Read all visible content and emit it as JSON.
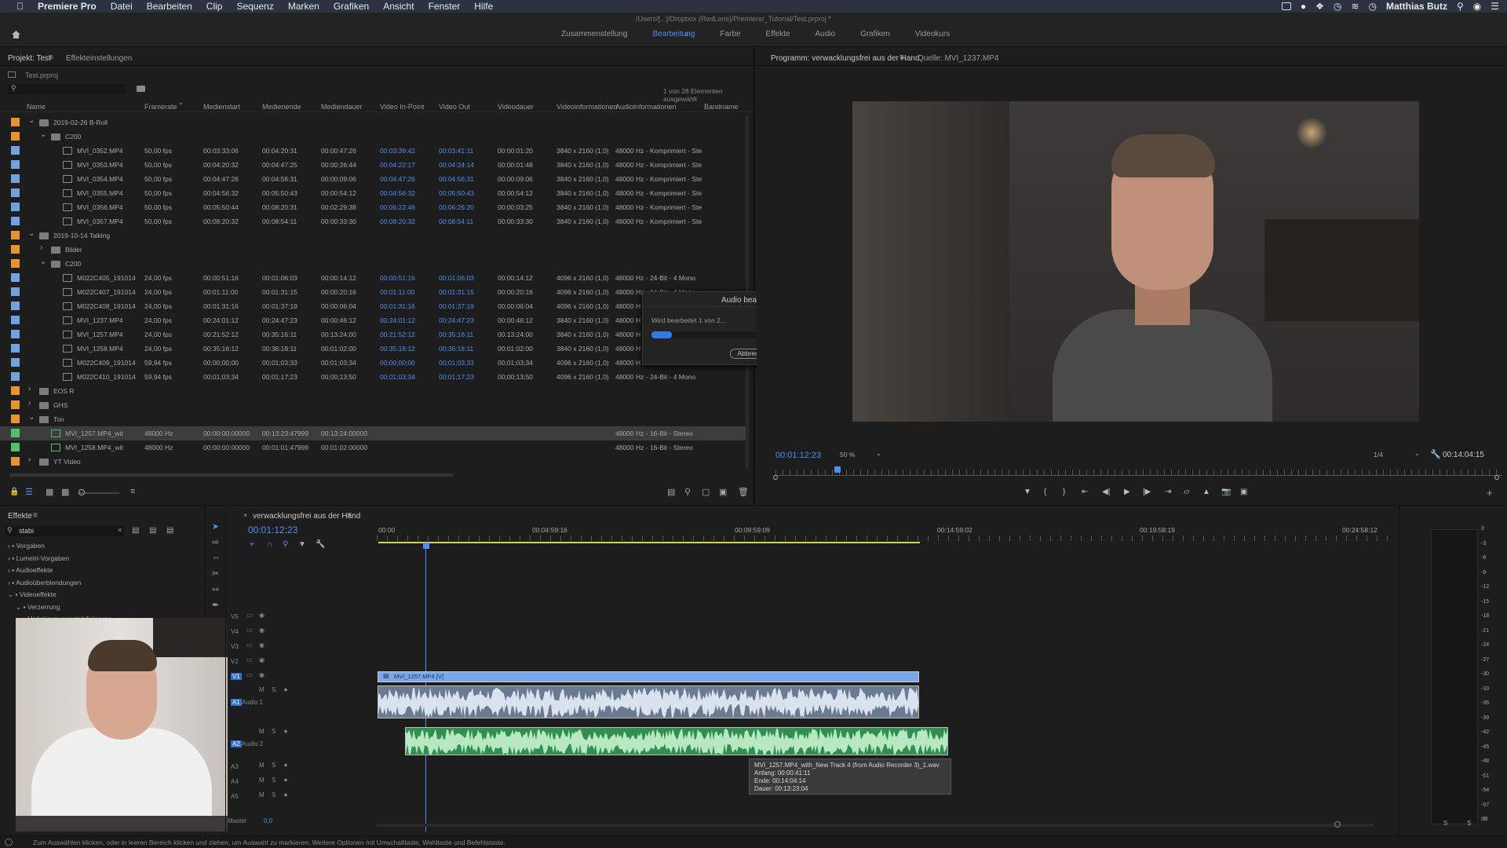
{
  "menubar": {
    "apple": "",
    "app": "Premiere Pro",
    "items": [
      "Datei",
      "Bearbeiten",
      "Clip",
      "Sequenz",
      "Marken",
      "Grafiken",
      "Ansicht",
      "Fenster",
      "Hilfe"
    ],
    "user": "Matthias Butz"
  },
  "window": {
    "path": "/Users/[...]/Dropbox (RedLens)/Premiere/_Tutorial/Test.prproj *"
  },
  "workspaces": {
    "tabs": [
      "Zusammenstellung",
      "Bearbeitung",
      "Farbe",
      "Effekte",
      "Audio",
      "Grafiken",
      "Videokurs"
    ],
    "active": "Bearbeitung"
  },
  "project": {
    "tab_project": "Projekt: Test",
    "tab_effects": "Effekteinstellungen",
    "file": "Test.prproj",
    "selection_info": "1 von 28 Elementen ausgewählt",
    "columns": [
      "Name",
      "Framerate",
      "Medienstart",
      "Medienende",
      "Mediendauer",
      "Video In-Point",
      "Video Out",
      "Videodauer",
      "Videoinformationen",
      "Audioinformationen",
      "Bandname"
    ],
    "rows": [
      {
        "type": "folder",
        "level": 1,
        "open": true,
        "color": "#e8932b",
        "name": "2019-02-26 B-Roll"
      },
      {
        "type": "folder",
        "level": 2,
        "open": true,
        "color": "#e8932b",
        "name": "C200"
      },
      {
        "type": "clip",
        "level": 3,
        "color": "#6fa2e0",
        "name": "MVI_0352.MP4",
        "fps": "50,00 fps",
        "ms": "00:03:33:06",
        "me": "00:04:20:31",
        "md": "00:00:47:26",
        "vi": "00:03:39:42",
        "vo": "00:03:41:11",
        "vd": "00:00:01:20",
        "vinfo": "3840 x 2160 (1,0)",
        "ainfo": "48000 Hz - Komprimiert - Ste"
      },
      {
        "type": "clip",
        "level": 3,
        "color": "#6fa2e0",
        "name": "MVI_0353.MP4",
        "fps": "50,00 fps",
        "ms": "00:04:20:32",
        "me": "00:04:47:25",
        "md": "00:00:26:44",
        "vi": "00:04:22:17",
        "vo": "00:04:24:14",
        "vd": "00:00:01:48",
        "vinfo": "3840 x 2160 (1,0)",
        "ainfo": "48000 Hz - Komprimiert - Ste"
      },
      {
        "type": "clip",
        "level": 3,
        "color": "#6fa2e0",
        "name": "MVI_0354.MP4",
        "fps": "50,00 fps",
        "ms": "00:04:47:26",
        "me": "00:04:56:31",
        "md": "00:00:09:06",
        "vi": "00:04:47:26",
        "vo": "00:04:56:31",
        "vd": "00:00:09:06",
        "vinfo": "3840 x 2160 (1,0)",
        "ainfo": "48000 Hz - Komprimiert - Ste"
      },
      {
        "type": "clip",
        "level": 3,
        "color": "#6fa2e0",
        "name": "MVI_0355.MP4",
        "fps": "50,00 fps",
        "ms": "00:04:56:32",
        "me": "00:05:50:43",
        "md": "00:00:54:12",
        "vi": "00:04:56:32",
        "vo": "00:05:50:43",
        "vd": "00:00:54:12",
        "vinfo": "3840 x 2160 (1,0)",
        "ainfo": "48000 Hz - Komprimiert - Ste"
      },
      {
        "type": "clip",
        "level": 3,
        "color": "#6fa2e0",
        "name": "MVI_0356.MP4",
        "fps": "50,00 fps",
        "ms": "00:05:50:44",
        "me": "00:08:20:31",
        "md": "00:02:29:38",
        "vi": "00:06:22:46",
        "vo": "00:06:26:20",
        "vd": "00:00:03:25",
        "vinfo": "3840 x 2160 (1,0)",
        "ainfo": "48000 Hz - Komprimiert - Ste"
      },
      {
        "type": "clip",
        "level": 3,
        "color": "#6fa2e0",
        "name": "MVI_0357.MP4",
        "fps": "50,00 fps",
        "ms": "00:08:20:32",
        "me": "00:08:54:11",
        "md": "00:00:33:30",
        "vi": "00:08:20:32",
        "vo": "00:08:54:11",
        "vd": "00:00:33:30",
        "vinfo": "3840 x 2160 (1,0)",
        "ainfo": "48000 Hz - Komprimiert - Ste"
      },
      {
        "type": "folder",
        "level": 1,
        "open": true,
        "color": "#e8932b",
        "name": "2019-10-14 Talking"
      },
      {
        "type": "folder",
        "level": 2,
        "open": false,
        "color": "#e8932b",
        "name": "Bilder"
      },
      {
        "type": "folder",
        "level": 2,
        "open": true,
        "color": "#e8932b",
        "name": "C200"
      },
      {
        "type": "clip",
        "level": 3,
        "color": "#6fa2e0",
        "name": "M022C405_191014",
        "fps": "24,00 fps",
        "ms": "00:00:51:16",
        "me": "00:01:06:03",
        "md": "00:00:14:12",
        "vi": "00:00:51:16",
        "vo": "00:01:06:03",
        "vd": "00:00:14:12",
        "vinfo": "4096 x 2160 (1,0)",
        "ainfo": "48000 Hz - 24-Bit - 4 Mono"
      },
      {
        "type": "clip",
        "level": 3,
        "color": "#6fa2e0",
        "name": "M022C407_191014",
        "fps": "24,00 fps",
        "ms": "00:01:11:00",
        "me": "00:01:31:15",
        "md": "00:00:20:16",
        "vi": "00:01:11:00",
        "vo": "00:01:31:15",
        "vd": "00:00:20:16",
        "vinfo": "4096 x 2160 (1,0)",
        "ainfo": "48000 Hz - 24-Bit - 4 Mono"
      },
      {
        "type": "clip",
        "level": 3,
        "color": "#6fa2e0",
        "name": "M022C408_191014",
        "fps": "24,00 fps",
        "ms": "00:01:31:16",
        "me": "00:01:37:19",
        "md": "00:00:06:04",
        "vi": "00:01:31:16",
        "vo": "00:01:37:19",
        "vd": "00:00:06:04",
        "vinfo": "4096 x 2160 (1,0)",
        "ainfo": "48000 H"
      },
      {
        "type": "clip",
        "level": 3,
        "color": "#6fa2e0",
        "name": "MVI_1237.MP4",
        "fps": "24,00 fps",
        "ms": "00:24:01:12",
        "me": "00:24:47:23",
        "md": "00:00:46:12",
        "vi": "00:24:01:12",
        "vo": "00:24:47:23",
        "vd": "00:00:46:12",
        "vinfo": "3840 x 2160 (1,0)",
        "ainfo": "48000 H"
      },
      {
        "type": "clip",
        "level": 3,
        "color": "#6fa2e0",
        "name": "MVI_1257.MP4",
        "fps": "24,00 fps",
        "ms": "00:21:52:12",
        "me": "00:35:16:11",
        "md": "00:13:24:00",
        "vi": "00:21:52:12",
        "vo": "00:35:16:11",
        "vd": "00:13:24:00",
        "vinfo": "3840 x 2160 (1,0)",
        "ainfo": "48000 H"
      },
      {
        "type": "clip",
        "level": 3,
        "color": "#6fa2e0",
        "name": "MVI_1258.MP4",
        "fps": "24,00 fps",
        "ms": "00:35:16:12",
        "me": "00:36:18:11",
        "md": "00:01:02:00",
        "vi": "00:35:16:12",
        "vo": "00:36:18:11",
        "vd": "00:01:02:00",
        "vinfo": "3840 x 2160 (1,0)",
        "ainfo": "48000 H"
      },
      {
        "type": "clip",
        "level": 3,
        "color": "#6fa2e0",
        "name": "M022C409_191014",
        "fps": "59,94 fps",
        "ms": "00;00;00;00",
        "me": "00;01;03;33",
        "md": "00;01;03;34",
        "vi": "00;00;00;00",
        "vo": "00;01;03;33",
        "vd": "00;01;03;34",
        "vinfo": "4096 x 2160 (1,0)",
        "ainfo": "48000 H"
      },
      {
        "type": "clip",
        "level": 3,
        "color": "#6fa2e0",
        "name": "M022C410_191014",
        "fps": "59,94 fps",
        "ms": "00;01;03;34",
        "me": "00;01;17;23",
        "md": "00;00;13;50",
        "vi": "00;01;03;34",
        "vo": "00;01;17;23",
        "vd": "00;00;13;50",
        "vinfo": "4096 x 2160 (1,0)",
        "ainfo": "48000 Hz - 24-Bit - 4 Mono"
      },
      {
        "type": "folder",
        "level": 1,
        "open": false,
        "color": "#e8932b",
        "name": "EOS R"
      },
      {
        "type": "folder",
        "level": 1,
        "open": false,
        "color": "#e8932b",
        "name": "GHS"
      },
      {
        "type": "folder",
        "level": 1,
        "open": true,
        "color": "#e8932b",
        "name": "Ton"
      },
      {
        "type": "audio",
        "level": 2,
        "color": "#4fc26a",
        "selected": true,
        "name": "MVI_1257.MP4_wit",
        "fps": "48000 Hz",
        "ms": "00:00:00:00000",
        "me": "00:13:23:47999",
        "md": "00:13:24:00000",
        "ainfo": "48000 Hz - 16-Bit - Stereo"
      },
      {
        "type": "audio",
        "level": 2,
        "color": "#4fc26a",
        "name": "MVI_1258.MP4_wit",
        "fps": "48000 Hz",
        "ms": "00:00:00:00000",
        "me": "00:01:01:47999",
        "md": "00:01:02:00000",
        "ainfo": "48000 Hz - 16-Bit - Stereo"
      },
      {
        "type": "folder",
        "level": 1,
        "open": false,
        "color": "#e8932b",
        "name": "YT Video"
      }
    ]
  },
  "dialog": {
    "title": "Audio bearbeiten...",
    "message": "Wird bearbeitet 1 von 2...",
    "progress": 0.1,
    "cancel": "Abbrechen"
  },
  "program": {
    "tab_program": "Programm: verwacklungsfrei aus der Hand",
    "tab_source": "Quelle: MVI_1237.MP4",
    "timecode": "00:01:12:23",
    "zoom": "50 %",
    "quality": "1/4",
    "duration": "00:14:04:15"
  },
  "effects": {
    "tab": "Effekte",
    "search": "stabi",
    "tree": [
      {
        "label": "Vorgaben",
        "level": 0
      },
      {
        "label": "Lumetri-Vorgaben",
        "level": 0
      },
      {
        "label": "Audioeffekte",
        "level": 0
      },
      {
        "label": "Audioüberblendungen",
        "level": 0
      },
      {
        "label": "Videoeffekte",
        "level": 0
      },
      {
        "label": "Verzerrung",
        "level": 1
      },
      {
        "label": "Verkrümmungsstabilisierung",
        "level": 2
      }
    ]
  },
  "timeline": {
    "tab": "verwacklungsfrei aus der Hand",
    "timecode": "00:01:12:23",
    "ruler": [
      "00:00",
      "00:04:59:16",
      "00:09:59:09",
      "00:14:59:02",
      "00:19:58:19",
      "00:24:58:12"
    ],
    "video_tracks": [
      "V5",
      "V4",
      "V3",
      "V2",
      "V1"
    ],
    "audio_tracks": [
      "A1",
      "A2",
      "A3",
      "A4",
      "A5"
    ],
    "audio_names": [
      "Audio 1",
      "Audio 2"
    ],
    "master_label": "Master",
    "master_value": "0,0",
    "video_clip": "MVI_1257.MP4 [V]",
    "tooltip": [
      "MVI_1257.MP4_with_New Track 4 (from Audio Recorder 3)_1.wav",
      "Anfang: 00:00:41:11",
      "Ende: 00:14:04:14",
      "Dauer: 00:13:23:04"
    ]
  },
  "meter": {
    "scale": [
      "0",
      "-3",
      "-6",
      "-9",
      "-12",
      "-15",
      "-18",
      "-21",
      "-24",
      "-27",
      "-30",
      "-33",
      "-36",
      "-39",
      "-42",
      "-45",
      "-48",
      "-51",
      "-54",
      "-57",
      "dB"
    ],
    "bottom": [
      "S",
      "S"
    ]
  },
  "status": {
    "text": "Zum Auswählen klicken, oder in leeren Bereich klicken und ziehen, um Auswahl zu markieren. Weitere Optionen mit Umschalttaste, Wahltaste und Befehlstaste."
  }
}
